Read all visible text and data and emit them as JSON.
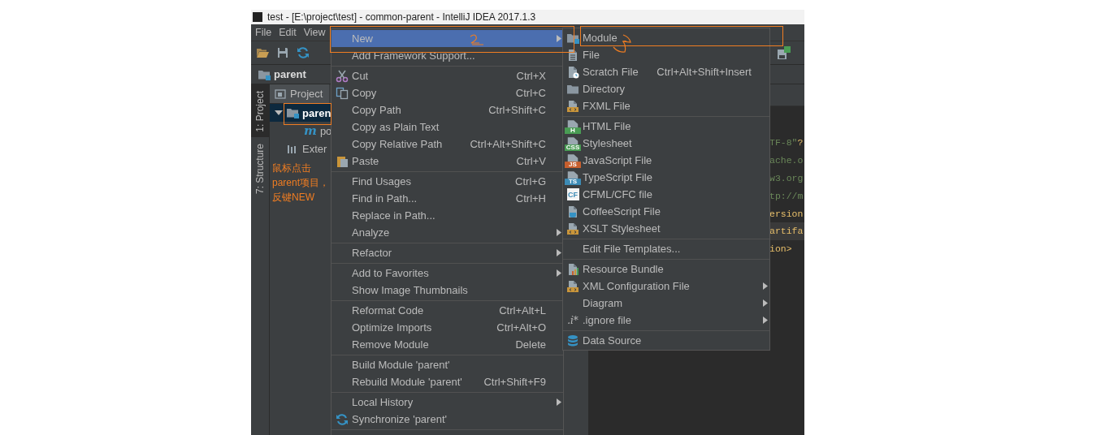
{
  "window": {
    "title": "test - [E:\\project\\test] - common-parent - IntelliJ IDEA 2017.1.3"
  },
  "menu_bar": [
    "File",
    "Edit",
    "View"
  ],
  "breadcrumb": {
    "label": "parent"
  },
  "tool_windows": [
    {
      "label": "1: Project",
      "selected": true
    },
    {
      "label": "7: Structure",
      "selected": false
    }
  ],
  "project_panel": {
    "title": "Project",
    "tree": [
      {
        "label": "paren",
        "selected": true,
        "expanded": true,
        "children": [
          {
            "label": "po",
            "badge": "m",
            "selected": false
          }
        ]
      },
      {
        "label": "Exter",
        "selected": false
      }
    ]
  },
  "editor": {
    "lines": [
      {
        "current": false,
        "parts": [
          {
            "text": "TF-8\"",
            "kind": "value"
          },
          {
            "text": "?",
            "kind": "tag"
          }
        ]
      },
      {
        "current": false,
        "parts": [
          {
            "text": "ache.o",
            "kind": "value"
          }
        ]
      },
      {
        "current": false,
        "parts": [
          {
            "text": "w3.org",
            "kind": "value"
          }
        ]
      },
      {
        "current": false,
        "parts": [
          {
            "text": "tp://m",
            "kind": "value"
          }
        ]
      },
      {
        "current": false,
        "parts": [
          {
            "text": "ersion",
            "kind": "tag"
          }
        ]
      },
      {
        "current": true,
        "parts": [
          {
            "text": "artifa",
            "kind": "tag"
          }
        ]
      },
      {
        "current": false,
        "parts": [
          {
            "text": "ion>",
            "kind": "tag"
          }
        ]
      }
    ]
  },
  "context_menu": {
    "cut_off": true,
    "groups": [
      {
        "items": [
          {
            "label": "New",
            "selected": true,
            "submenu": true
          },
          {
            "label": "Add Framework Support...",
            "selected": false,
            "submenu": false
          }
        ]
      },
      {
        "items": [
          {
            "label": "Cut",
            "shortcut": "Ctrl+X",
            "selected": false,
            "submenu": false
          },
          {
            "label": "Copy",
            "shortcut": "Ctrl+C",
            "selected": false,
            "submenu": false
          },
          {
            "label": "Copy Path",
            "shortcut": "Ctrl+Shift+C",
            "selected": false,
            "submenu": false
          },
          {
            "label": "Copy as Plain Text",
            "selected": false,
            "submenu": false
          },
          {
            "label": "Copy Relative Path",
            "shortcut": "Ctrl+Alt+Shift+C",
            "selected": false,
            "submenu": false
          },
          {
            "label": "Paste",
            "shortcut": "Ctrl+V",
            "selected": false,
            "submenu": false
          }
        ]
      },
      {
        "items": [
          {
            "label": "Find Usages",
            "shortcut": "Ctrl+G",
            "selected": false,
            "submenu": false
          },
          {
            "label": "Find in Path...",
            "shortcut": "Ctrl+H",
            "selected": false,
            "submenu": false
          },
          {
            "label": "Replace in Path...",
            "selected": false,
            "submenu": false
          },
          {
            "label": "Analyze",
            "selected": false,
            "submenu": true
          }
        ]
      },
      {
        "items": [
          {
            "label": "Refactor",
            "selected": false,
            "submenu": true
          }
        ]
      },
      {
        "items": [
          {
            "label": "Add to Favorites",
            "selected": false,
            "submenu": true
          },
          {
            "label": "Show Image Thumbnails",
            "selected": false,
            "submenu": false
          }
        ]
      },
      {
        "items": [
          {
            "label": "Reformat Code",
            "shortcut": "Ctrl+Alt+L",
            "selected": false,
            "submenu": false
          },
          {
            "label": "Optimize Imports",
            "shortcut": "Ctrl+Alt+O",
            "selected": false,
            "submenu": false
          },
          {
            "label": "Remove Module",
            "shortcut": "Delete",
            "selected": false,
            "submenu": false
          }
        ]
      },
      {
        "items": [
          {
            "label": "Build Module 'parent'",
            "selected": false,
            "submenu": false
          },
          {
            "label": "Rebuild Module 'parent'",
            "shortcut": "Ctrl+Shift+F9",
            "selected": false,
            "submenu": false
          }
        ]
      },
      {
        "items": [
          {
            "label": "Local History",
            "selected": false,
            "submenu": true
          },
          {
            "label": "Synchronize 'parent'",
            "selected": false,
            "submenu": false
          }
        ]
      }
    ]
  },
  "submenu": {
    "groups": [
      {
        "items": [
          {
            "label": "Module",
            "selected": false,
            "submenu": false
          },
          {
            "label": "File",
            "selected": false,
            "submenu": false
          },
          {
            "label": "Scratch File",
            "shortcut": "Ctrl+Alt+Shift+Insert",
            "selected": false,
            "submenu": false
          },
          {
            "label": "Directory",
            "selected": false,
            "submenu": false
          },
          {
            "label": "FXML File",
            "selected": false,
            "submenu": false
          }
        ]
      },
      {
        "items": [
          {
            "label": "HTML File",
            "badge": "H",
            "selected": false,
            "submenu": false
          },
          {
            "label": "Stylesheet",
            "badge": "CSS",
            "selected": false,
            "submenu": false
          },
          {
            "label": "JavaScript File",
            "badge": "JS",
            "selected": false,
            "submenu": false
          },
          {
            "label": "TypeScript File",
            "badge": "TS",
            "selected": false,
            "submenu": false
          },
          {
            "label": "CFML/CFC file",
            "badge": "CF",
            "selected": false,
            "submenu": false
          },
          {
            "label": "CoffeeScript File",
            "selected": false,
            "submenu": false
          },
          {
            "label": "XSLT Stylesheet",
            "selected": false,
            "submenu": false
          }
        ]
      },
      {
        "items": [
          {
            "label": "Edit File Templates...",
            "selected": false,
            "submenu": false
          }
        ]
      },
      {
        "items": [
          {
            "label": "Resource Bundle",
            "selected": false,
            "submenu": false
          },
          {
            "label": "XML Configuration File",
            "selected": false,
            "submenu": true
          },
          {
            "label": "Diagram",
            "selected": false,
            "submenu": true
          },
          {
            "label": ".ignore file",
            "badge": ".i*",
            "selected": false,
            "submenu": true
          }
        ]
      },
      {
        "items": [
          {
            "label": "Data Source",
            "selected": false,
            "submenu": false
          }
        ]
      }
    ]
  },
  "annotation": {
    "text": "鼠标点击parent项目，反键NEW"
  }
}
